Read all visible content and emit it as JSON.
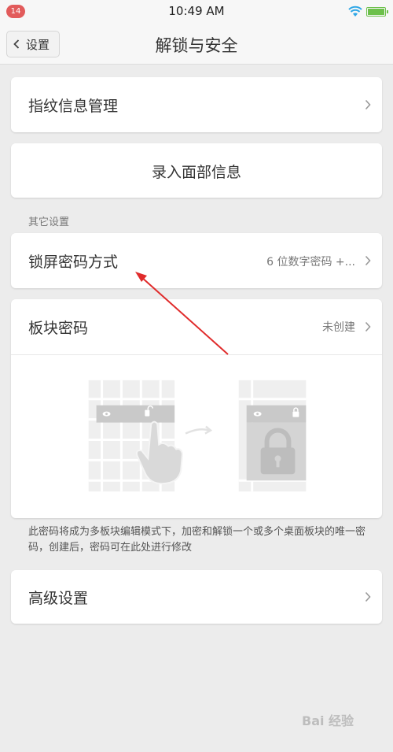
{
  "status_bar": {
    "badge_count": "14",
    "time": "10:49 AM",
    "icons": [
      "wifi-icon",
      "battery-icon"
    ]
  },
  "nav": {
    "back_label": "设置",
    "title": "解锁与安全"
  },
  "rows": {
    "fingerprint": {
      "label": "指纹信息管理"
    },
    "face": {
      "label": "录入面部信息"
    },
    "other_settings_header": "其它设置",
    "lock_screen": {
      "label": "锁屏密码方式",
      "value": "6 位数字密码 +..."
    },
    "block_password": {
      "label": "板块密码",
      "value": "未创建"
    },
    "block_description": "此密码将成为多板块编辑模式下，加密和解锁一个或多个桌面板块的唯一密码，创建后，密码可在此处进行修改",
    "advanced": {
      "label": "高级设置"
    }
  },
  "colors": {
    "accent_badge": "#e25b5b",
    "battery": "#6cc04a",
    "wifi": "#2fa7e6",
    "arrow": "#e02b2b"
  },
  "watermark": "Bai 经验"
}
